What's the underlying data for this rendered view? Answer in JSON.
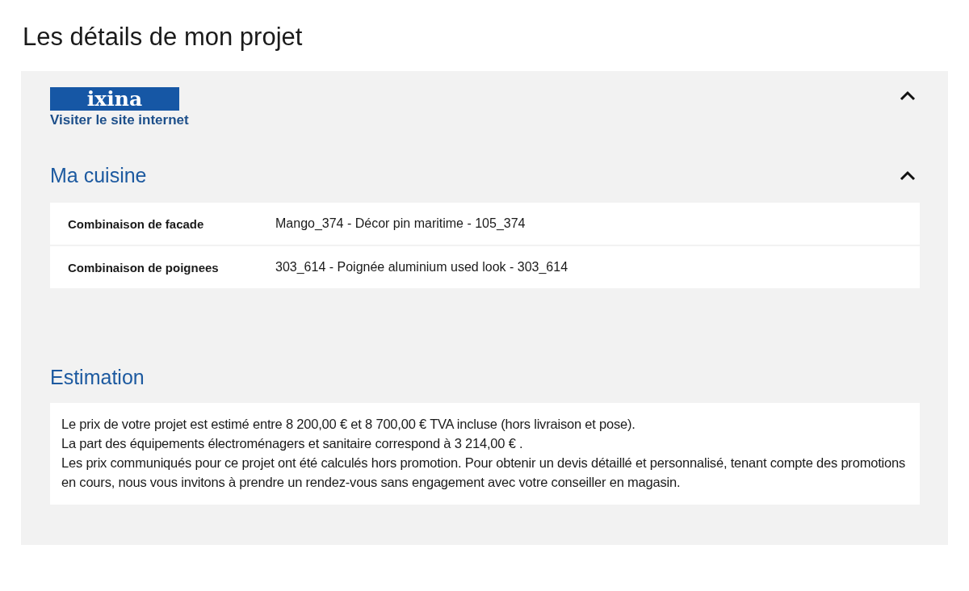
{
  "page_title": "Les détails de mon projet",
  "brand": {
    "logo": "ixina",
    "link": "Visiter le site internet",
    "expanded": true
  },
  "kitchen": {
    "title": "Ma cuisine",
    "expanded": true,
    "rows": [
      {
        "label": "Combinaison de facade",
        "value": "Mango_374 - Décor pin maritime - 105_374"
      },
      {
        "label": "Combinaison de poignees",
        "value": "303_614 - Poignée aluminium used look - 303_614"
      }
    ]
  },
  "estimation": {
    "title": "Estimation",
    "paragraphs": [
      "Le prix de votre projet est estimé entre 8 200,00 € et 8 700,00 € TVA incluse (hors livraison et pose).",
      "La part des équipements électroménagers et sanitaire correspond à 3 214,00 € .",
      "Les prix communiqués pour ce projet ont été calculés hors promotion. Pour obtenir un devis détaillé et personnalisé, tenant compte des promotions en cours, nous vous invitons à prendre un rendez-vous sans engagement avec votre conseiller en magasin."
    ]
  }
}
